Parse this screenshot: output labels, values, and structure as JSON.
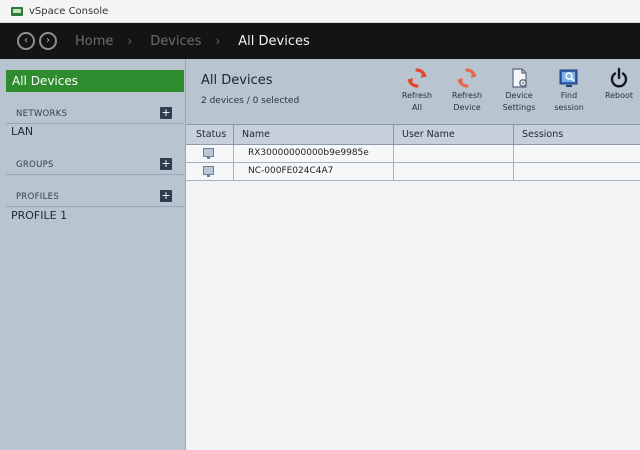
{
  "window": {
    "title": "vSpace Console"
  },
  "nav": {
    "back_glyph": "‹",
    "forward_glyph": "›",
    "breadcrumbs": [
      "Home",
      "Devices",
      "All Devices"
    ],
    "separator": "›"
  },
  "sidebar": {
    "all_devices": "All Devices",
    "networks": {
      "label": "NETWORKS",
      "items": [
        "LAN"
      ]
    },
    "groups": {
      "label": "GROUPS",
      "items": []
    },
    "profiles": {
      "label": "PROFILES",
      "items": [
        "PROFILE 1"
      ]
    },
    "add_glyph": "+"
  },
  "content": {
    "title": "All Devices",
    "subtitle": "2 devices / 0 selected"
  },
  "toolbar": {
    "refresh_all": {
      "line1": "Refresh",
      "line2": "All"
    },
    "refresh_device": {
      "line1": "Refresh",
      "line2": "Device"
    },
    "device_settings": {
      "line1": "Device",
      "line2": "Settings"
    },
    "find_session": {
      "line1": "Find",
      "line2": "session"
    },
    "reboot": {
      "line1": "Reboot",
      "line2": ""
    }
  },
  "table": {
    "columns": [
      "Status",
      "Name",
      "User Name",
      "Sessions"
    ],
    "rows": [
      {
        "name": "RX30000000000b9e9985e",
        "user": "",
        "sessions": ""
      },
      {
        "name": "NC-000FE024C4A7",
        "user": "",
        "sessions": ""
      }
    ]
  },
  "colors": {
    "accent_green": "#2e8b2e",
    "refresh_red": "#e04a2c",
    "nav_dark": "#141414"
  }
}
